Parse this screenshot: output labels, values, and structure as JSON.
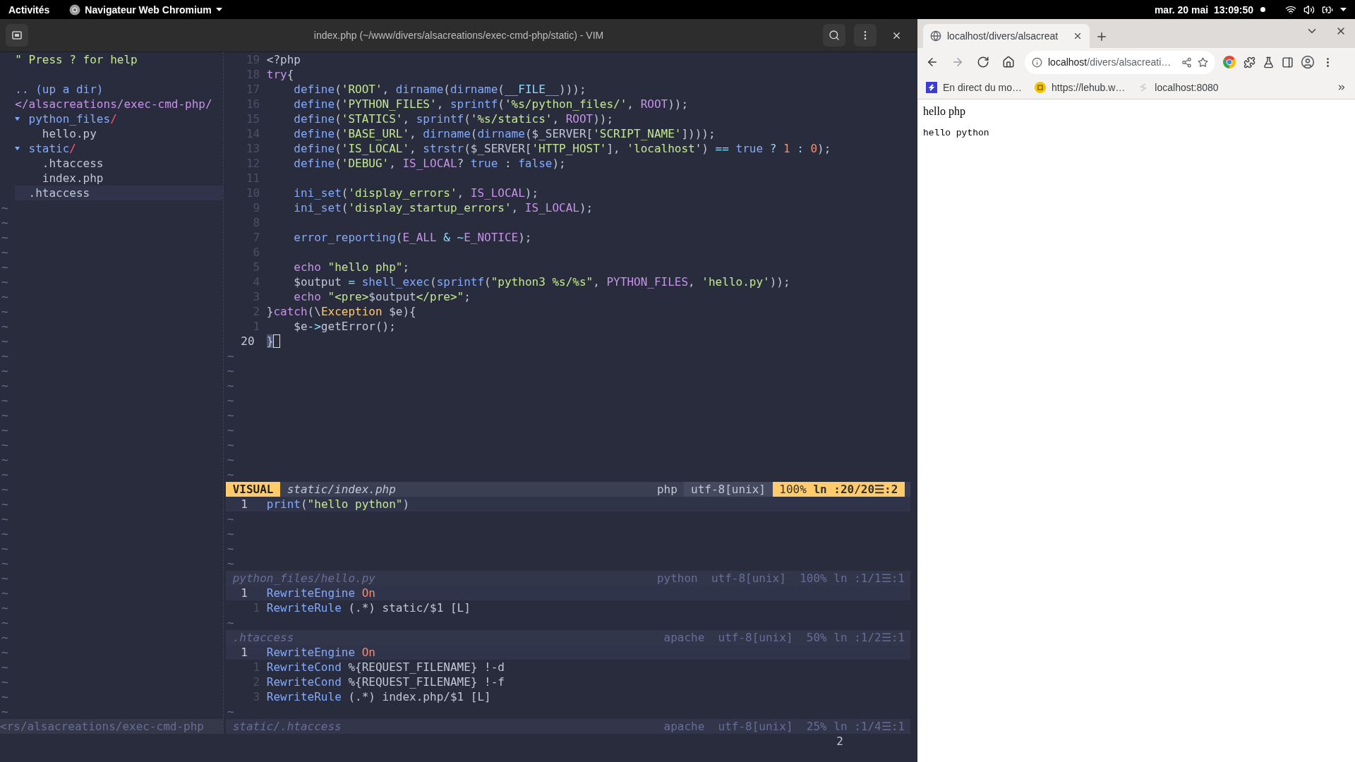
{
  "top_bar": {
    "activities": "Activités",
    "app_menu": "Navigateur Web Chromium",
    "clock": "mar. 20 mai  13:09:50",
    "notification_dot": true
  },
  "vim_window": {
    "title": "index.php (~/www/divers/alsacreations/exec-cmd-php/static) - VIM"
  },
  "file_tree": {
    "help": "\" Press ? for help",
    "items": [
      {
        "kind": "updir",
        "text": ".. (up a dir)",
        "selected": false
      },
      {
        "kind": "root",
        "text": "</alsacreations/exec-cmd-php/",
        "selected": false
      },
      {
        "kind": "dir",
        "name": "python_files",
        "slash": "/",
        "expanded": true,
        "selected": false,
        "children": [
          {
            "kind": "file",
            "name": "hello.py",
            "selected": false
          }
        ]
      },
      {
        "kind": "dir",
        "name": "static",
        "slash": "/",
        "expanded": true,
        "selected": false,
        "children": [
          {
            "kind": "file",
            "name": ".htaccess",
            "selected": false
          },
          {
            "kind": "file",
            "name": "index.php",
            "selected": false
          }
        ]
      },
      {
        "kind": "file",
        "name": ".htaccess",
        "selected": true
      }
    ],
    "filler": [
      "~",
      "~",
      "~",
      "~",
      "~",
      "~",
      "~",
      "~",
      "~",
      "~",
      "~",
      "~",
      "~",
      "~",
      "~",
      "~",
      "~",
      "~",
      "~",
      "~",
      "~",
      "~",
      "~",
      "~",
      "~",
      "~",
      "~",
      "~",
      "~",
      "~",
      "~",
      "~",
      "~",
      "~",
      "~"
    ],
    "statusline": "<rs/alsacreations/exec-cmd-php"
  },
  "windows": [
    {
      "lines": [
        {
          "n": "19",
          "indented": false,
          "current": false,
          "cursorline": false,
          "cursor": false,
          "tokens": [
            {
              "kind": "p",
              "text": "<?php"
            }
          ]
        },
        {
          "n": "18",
          "indented": false,
          "current": false,
          "cursorline": false,
          "cursor": false,
          "tokens": [
            {
              "kind": "kw",
              "text": "try"
            },
            {
              "kind": "p",
              "text": "{"
            }
          ]
        },
        {
          "n": "17",
          "indented": true,
          "current": false,
          "cursorline": false,
          "cursor": false,
          "tokens": [
            {
              "kind": "fn",
              "text": "define"
            },
            {
              "kind": "p",
              "text": "("
            },
            {
              "kind": "str",
              "text": "'ROOT'"
            },
            {
              "kind": "p",
              "text": ", "
            },
            {
              "kind": "fn",
              "text": "dirname"
            },
            {
              "kind": "p",
              "text": "("
            },
            {
              "kind": "fn",
              "text": "dirname"
            },
            {
              "kind": "p",
              "text": "("
            },
            {
              "kind": "mg",
              "text": "__FILE__"
            },
            {
              "kind": "p",
              "text": ")));"
            }
          ]
        },
        {
          "n": "16",
          "indented": true,
          "current": false,
          "cursorline": false,
          "cursor": false,
          "tokens": [
            {
              "kind": "fn",
              "text": "define"
            },
            {
              "kind": "p",
              "text": "("
            },
            {
              "kind": "str",
              "text": "'PYTHON_FILES'"
            },
            {
              "kind": "p",
              "text": ", "
            },
            {
              "kind": "fn",
              "text": "sprintf"
            },
            {
              "kind": "p",
              "text": "("
            },
            {
              "kind": "str",
              "text": "'%s/python_files/'"
            },
            {
              "kind": "p",
              "text": ", "
            },
            {
              "kind": "cst",
              "text": "ROOT"
            },
            {
              "kind": "p",
              "text": "));"
            }
          ]
        },
        {
          "n": "15",
          "indented": true,
          "current": false,
          "cursorline": false,
          "cursor": false,
          "tokens": [
            {
              "kind": "fn",
              "text": "define"
            },
            {
              "kind": "p",
              "text": "("
            },
            {
              "kind": "str",
              "text": "'STATICS'"
            },
            {
              "kind": "p",
              "text": ", "
            },
            {
              "kind": "fn",
              "text": "sprintf"
            },
            {
              "kind": "p",
              "text": "("
            },
            {
              "kind": "str",
              "text": "'%s/statics'"
            },
            {
              "kind": "p",
              "text": ", "
            },
            {
              "kind": "cst",
              "text": "ROOT"
            },
            {
              "kind": "p",
              "text": "));"
            }
          ]
        },
        {
          "n": "14",
          "indented": true,
          "current": false,
          "cursorline": false,
          "cursor": false,
          "tokens": [
            {
              "kind": "fn",
              "text": "define"
            },
            {
              "kind": "p",
              "text": "("
            },
            {
              "kind": "str",
              "text": "'BASE_URL'"
            },
            {
              "kind": "p",
              "text": ", "
            },
            {
              "kind": "fn",
              "text": "dirname"
            },
            {
              "kind": "p",
              "text": "("
            },
            {
              "kind": "fn",
              "text": "dirname"
            },
            {
              "kind": "p",
              "text": "($_SERVER["
            },
            {
              "kind": "str",
              "text": "'SCRIPT_NAME'"
            },
            {
              "kind": "p",
              "text": "])));"
            }
          ]
        },
        {
          "n": "13",
          "indented": true,
          "current": false,
          "cursorline": false,
          "cursor": false,
          "tokens": [
            {
              "kind": "fn",
              "text": "define"
            },
            {
              "kind": "p",
              "text": "("
            },
            {
              "kind": "str",
              "text": "'IS_LOCAL'"
            },
            {
              "kind": "p",
              "text": ", "
            },
            {
              "kind": "fn",
              "text": "strstr"
            },
            {
              "kind": "p",
              "text": "($_SERVER["
            },
            {
              "kind": "str",
              "text": "'HTTP_HOST'"
            },
            {
              "kind": "p",
              "text": "], "
            },
            {
              "kind": "str",
              "text": "'localhost'"
            },
            {
              "kind": "p",
              "text": ") "
            },
            {
              "kind": "op",
              "text": "=="
            },
            {
              "kind": "bool",
              "text": " true"
            },
            {
              "kind": "op",
              "text": " ?"
            },
            {
              "kind": "num",
              "text": " 1"
            },
            {
              "kind": "op",
              "text": " :"
            },
            {
              "kind": "num",
              "text": " 0"
            },
            {
              "kind": "p",
              "text": ");"
            }
          ]
        },
        {
          "n": "12",
          "indented": true,
          "current": false,
          "cursorline": false,
          "cursor": false,
          "tokens": [
            {
              "kind": "fn",
              "text": "define"
            },
            {
              "kind": "p",
              "text": "("
            },
            {
              "kind": "str",
              "text": "'DEBUG'"
            },
            {
              "kind": "p",
              "text": ", "
            },
            {
              "kind": "cst",
              "text": "IS_LOCAL"
            },
            {
              "kind": "p",
              "text": "? "
            },
            {
              "kind": "bool",
              "text": "true"
            },
            {
              "kind": "p",
              "text": " : "
            },
            {
              "kind": "bool",
              "text": "false"
            },
            {
              "kind": "p",
              "text": ");"
            }
          ]
        },
        {
          "n": "11",
          "current": false,
          "cursorline": false,
          "cursor": false
        },
        {
          "n": "10",
          "indented": true,
          "current": false,
          "cursorline": false,
          "cursor": false,
          "tokens": [
            {
              "kind": "fn",
              "text": "ini_set"
            },
            {
              "kind": "p",
              "text": "("
            },
            {
              "kind": "str",
              "text": "'display_errors'"
            },
            {
              "kind": "p",
              "text": ", "
            },
            {
              "kind": "cst",
              "text": "IS_LOCAL"
            },
            {
              "kind": "p",
              "text": ");"
            }
          ]
        },
        {
          "n": "9",
          "indented": true,
          "current": false,
          "cursorline": false,
          "cursor": false,
          "tokens": [
            {
              "kind": "fn",
              "text": "ini_set"
            },
            {
              "kind": "p",
              "text": "("
            },
            {
              "kind": "str",
              "text": "'display_startup_errors'"
            },
            {
              "kind": "p",
              "text": ", "
            },
            {
              "kind": "cst",
              "text": "IS_LOCAL"
            },
            {
              "kind": "p",
              "text": ");"
            }
          ]
        },
        {
          "n": "8",
          "current": false,
          "cursorline": false,
          "cursor": false
        },
        {
          "n": "7",
          "indented": true,
          "current": false,
          "cursorline": false,
          "cursor": false,
          "tokens": [
            {
              "kind": "fn",
              "text": "error_reporting"
            },
            {
              "kind": "p",
              "text": "("
            },
            {
              "kind": "cst",
              "text": "E_ALL"
            },
            {
              "kind": "op",
              "text": " & ~"
            },
            {
              "kind": "cst",
              "text": "E_NOTICE"
            },
            {
              "kind": "p",
              "text": ");"
            }
          ]
        },
        {
          "n": "6",
          "current": false,
          "cursorline": false,
          "cursor": false
        },
        {
          "n": "5",
          "indented": true,
          "current": false,
          "cursorline": false,
          "cursor": false,
          "tokens": [
            {
              "kind": "kw",
              "text": "echo"
            },
            {
              "kind": "str",
              "text": " \"hello php\""
            },
            {
              "kind": "p",
              "text": ";"
            }
          ]
        },
        {
          "n": "4",
          "indented": true,
          "current": false,
          "cursorline": false,
          "cursor": false,
          "tokens": [
            {
              "kind": "p",
              "text": "$output "
            },
            {
              "kind": "op",
              "text": "="
            },
            {
              "kind": "fn",
              "text": " shell_exec"
            },
            {
              "kind": "p",
              "text": "("
            },
            {
              "kind": "fn",
              "text": "sprintf"
            },
            {
              "kind": "p",
              "text": "("
            },
            {
              "kind": "str",
              "text": "\"python3 %s/%s\""
            },
            {
              "kind": "p",
              "text": ", "
            },
            {
              "kind": "cst",
              "text": "PYTHON_FILES"
            },
            {
              "kind": "p",
              "text": ", "
            },
            {
              "kind": "str",
              "text": "'hello.py'"
            },
            {
              "kind": "p",
              "text": "));"
            }
          ]
        },
        {
          "n": "3",
          "indented": true,
          "current": false,
          "cursorline": false,
          "cursor": false,
          "tokens": [
            {
              "kind": "kw",
              "text": "echo"
            },
            {
              "kind": "str",
              "text": " \"<pre>"
            },
            {
              "kind": "p",
              "text": "$output"
            },
            {
              "kind": "str",
              "text": "</pre>\""
            },
            {
              "kind": "p",
              "text": ";"
            }
          ]
        },
        {
          "n": "2",
          "indented": false,
          "current": false,
          "cursorline": false,
          "cursor": false,
          "tokens": [
            {
              "kind": "p",
              "text": "}"
            },
            {
              "kind": "kw",
              "text": "catch"
            },
            {
              "kind": "p",
              "text": "(\\"
            },
            {
              "kind": "cls",
              "text": "Exception"
            },
            {
              "kind": "p",
              "text": " $e){"
            }
          ]
        },
        {
          "n": "1",
          "indented": true,
          "current": false,
          "cursorline": false,
          "cursor": false,
          "tokens": [
            {
              "kind": "p",
              "text": "$e"
            },
            {
              "kind": "op",
              "text": "->"
            },
            {
              "kind": "p",
              "text": "getError();"
            }
          ]
        },
        {
          "n": "20",
          "indented": false,
          "current": true,
          "cursorline": false,
          "cursor": true,
          "tokens": [
            {
              "kind": "sel",
              "text": "}"
            }
          ]
        }
      ],
      "filler": [
        "~",
        "~",
        "~",
        "~",
        "~",
        "~",
        "~",
        "~",
        "~"
      ],
      "statusline": {
        "active": true,
        "mode": "VISUAL",
        "file": "static/index.php",
        "filetype": "php",
        "encoding": "utf-8[unix]",
        "percent": "100%",
        "position": "ln :20/20☰:2"
      }
    },
    {
      "lines": [
        {
          "n": "1",
          "indented": false,
          "current": true,
          "cursorline": true,
          "cursor": false,
          "tokens": [
            {
              "kind": "fn",
              "text": "print"
            },
            {
              "kind": "p",
              "text": "("
            },
            {
              "kind": "str",
              "text": "\"hello python\""
            },
            {
              "kind": "p",
              "text": ")"
            }
          ]
        }
      ],
      "filler": [
        "~",
        "~",
        "~",
        "~"
      ],
      "statusline": {
        "active": false,
        "file": "python_files/hello.py",
        "filetype": "python",
        "encoding": "utf-8[unix]",
        "percent": "100%",
        "position": "ln :1/1☰:1"
      }
    },
    {
      "lines": [
        {
          "n": "1",
          "indented": false,
          "current": true,
          "cursorline": true,
          "cursor": false,
          "tokens": [
            {
              "kind": "fn",
              "text": "RewriteEngine"
            },
            {
              "kind": "num",
              "text": " On"
            }
          ]
        },
        {
          "n": "1",
          "indented": false,
          "current": false,
          "cursorline": false,
          "cursor": false,
          "tokens": [
            {
              "kind": "fn",
              "text": "RewriteRule"
            },
            {
              "kind": "p",
              "text": " (.*) static/$1 [L]"
            }
          ]
        }
      ],
      "filler": [
        "~"
      ],
      "statusline": {
        "active": false,
        "file": ".htaccess",
        "filetype": "apache",
        "encoding": "utf-8[unix]",
        "percent": "50%",
        "position": "ln :1/2☰:1"
      }
    },
    {
      "lines": [
        {
          "n": "1",
          "indented": false,
          "current": true,
          "cursorline": true,
          "cursor": false,
          "tokens": [
            {
              "kind": "fn",
              "text": "RewriteEngine"
            },
            {
              "kind": "num",
              "text": " On"
            }
          ]
        },
        {
          "n": "1",
          "indented": false,
          "current": false,
          "cursorline": false,
          "cursor": false,
          "tokens": [
            {
              "kind": "fn",
              "text": "RewriteCond"
            },
            {
              "kind": "p",
              "text": " %{REQUEST_FILENAME} !-d"
            }
          ]
        },
        {
          "n": "2",
          "indented": false,
          "current": false,
          "cursorline": false,
          "cursor": false,
          "tokens": [
            {
              "kind": "fn",
              "text": "RewriteCond"
            },
            {
              "kind": "p",
              "text": " %{REQUEST_FILENAME} !-f"
            }
          ]
        },
        {
          "n": "3",
          "indented": false,
          "current": false,
          "cursorline": false,
          "cursor": false,
          "tokens": [
            {
              "kind": "fn",
              "text": "RewriteRule"
            },
            {
              "kind": "p",
              "text": " (.*) index.php/$1 [L]"
            }
          ]
        }
      ],
      "filler": [
        "~"
      ],
      "statusline": {
        "active": false,
        "file": "static/.htaccess",
        "filetype": "apache",
        "encoding": "utf-8[unix]",
        "percent": "25%",
        "position": "ln :1/4☰:1"
      }
    }
  ],
  "command_line": {
    "showcmd": "2"
  },
  "browser": {
    "tabs": [
      {
        "title": "localhost/divers/alsacreat",
        "selected": true
      }
    ],
    "nav_buttons": [
      {
        "kind": "back",
        "disabled": false
      },
      {
        "kind": "forward",
        "disabled": true
      },
      {
        "kind": "reload",
        "disabled": false
      },
      {
        "kind": "home",
        "disabled": false
      }
    ],
    "address": {
      "host": "localhost",
      "path": "/divers/alsacreati…"
    },
    "bookmarks": [
      {
        "kind": "square",
        "label": "En direct du mo…"
      },
      {
        "kind": "coin",
        "label": "https://lehub.w…"
      },
      {
        "kind": "outline",
        "label": "localhost:8080"
      }
    ],
    "page": {
      "text": "hello php",
      "pre": "hello python"
    }
  }
}
